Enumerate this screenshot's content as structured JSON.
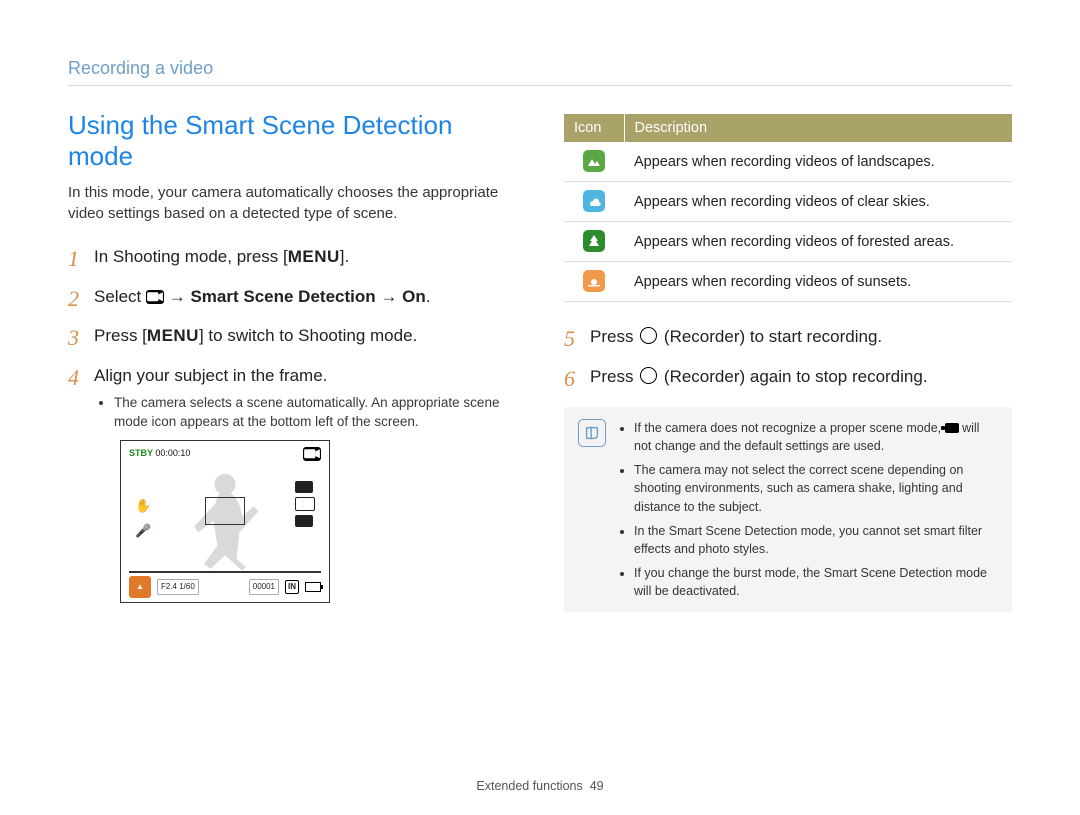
{
  "breadcrumb": "Recording a video",
  "heading": "Using the Smart Scene Detection mode",
  "intro": "In this mode, your camera automatically chooses the appropriate video settings based on a detected type of scene.",
  "steps": {
    "s1": {
      "num": "1",
      "prefix": "In Shooting mode, press [",
      "menu": "MENU",
      "suffix": "]."
    },
    "s2": {
      "num": "2",
      "select": "Select",
      "path_bold": "Smart Scene Detection",
      "on": "On",
      "arrow": "→"
    },
    "s3": {
      "num": "3",
      "prefix": "Press [",
      "menu": "MENU",
      "suffix": "] to switch to Shooting mode."
    },
    "s4": {
      "num": "4",
      "text": "Align your subject in the frame.",
      "bullet": "The camera selects a scene automatically. An appropriate scene mode icon appears at the bottom left of the screen."
    },
    "s5": {
      "num": "5",
      "prefix": "Press ",
      "mid": " (Recorder) to start recording."
    },
    "s6": {
      "num": "6",
      "prefix": "Press ",
      "mid": " (Recorder) again to stop recording."
    }
  },
  "preview": {
    "stby": "STBY",
    "time": "00:00:10",
    "f_info": "F2.4  1/60",
    "counter": "00001",
    "in": "IN"
  },
  "table": {
    "head_icon": "Icon",
    "head_desc": "Description",
    "rows": [
      {
        "desc": "Appears when recording videos of landscapes."
      },
      {
        "desc": "Appears when recording videos of clear skies."
      },
      {
        "desc": "Appears when recording videos of forested areas."
      },
      {
        "desc": "Appears when recording videos of sunsets."
      }
    ]
  },
  "notes": [
    {
      "pre": "If the camera does not recognize a proper scene mode, ",
      "post": " will not change and the default settings are used."
    },
    {
      "text": "The camera may not select the correct scene depending on shooting environments, such as camera shake, lighting and distance to the subject."
    },
    {
      "text": "In the Smart Scene Detection mode, you cannot set smart filter effects and photo styles."
    },
    {
      "text": "If you change the burst mode, the Smart Scene Detection mode will be deactivated."
    }
  ],
  "footer": {
    "section": "Extended functions",
    "page": "49"
  }
}
